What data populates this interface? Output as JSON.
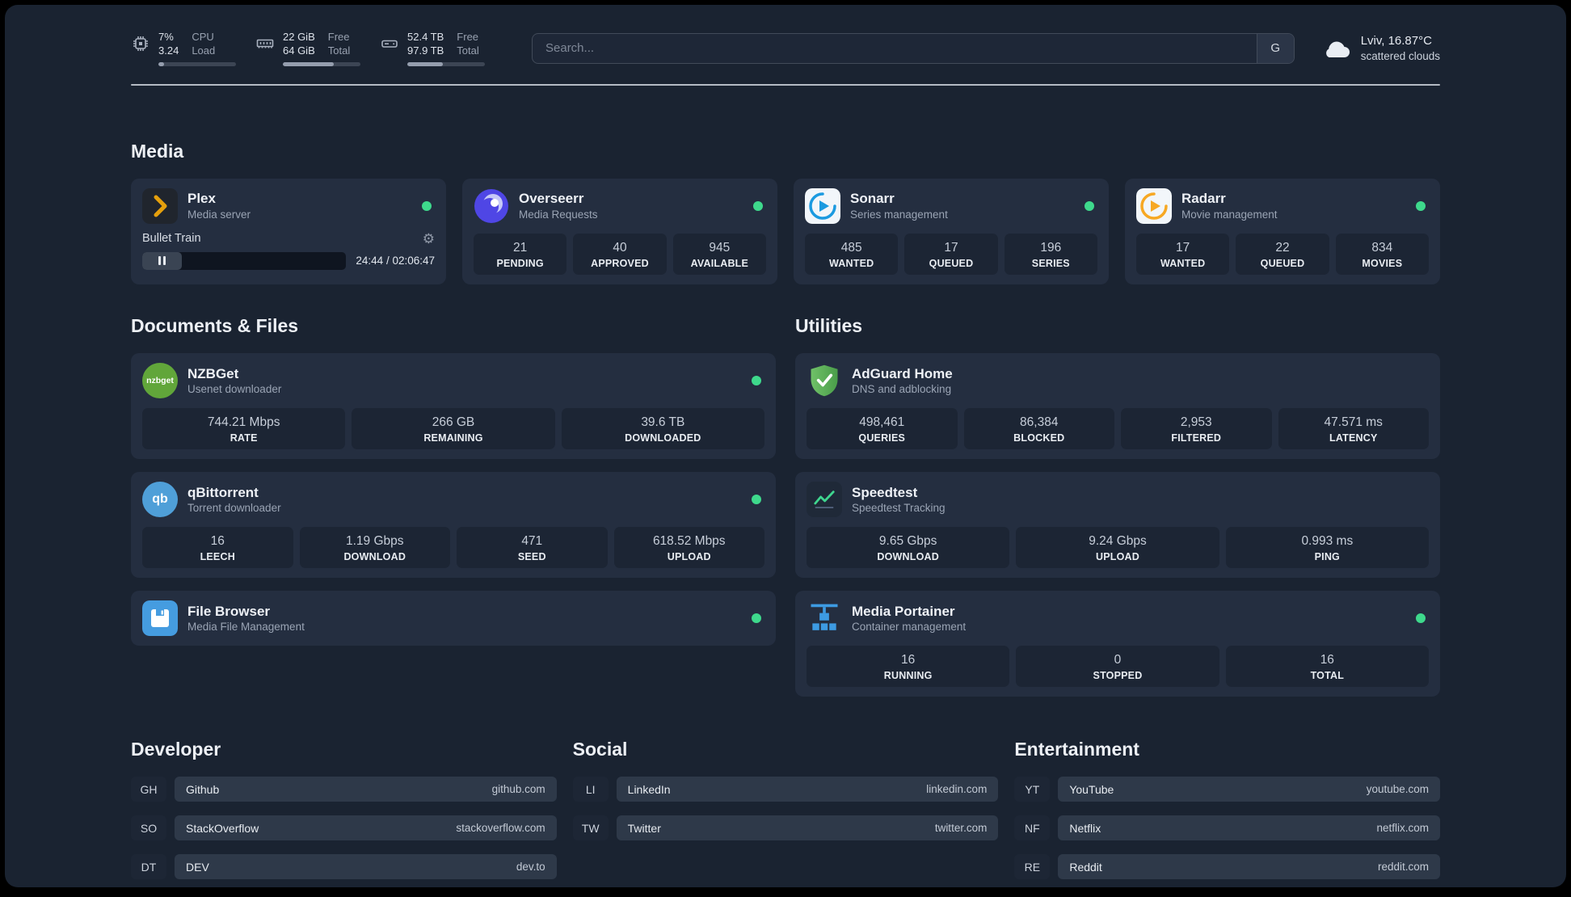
{
  "colors": {
    "status_ok": "#3ed98c",
    "accent_green_line": "#3fd68f",
    "plex_amber": "#e5a00d"
  },
  "topbar": {
    "cpu": {
      "value1": "7%",
      "value2": "3.24",
      "label1": "CPU",
      "label2": "Load",
      "bar_percent": 7
    },
    "memory": {
      "value1": "22 GiB",
      "value2": "64 GiB",
      "label1": "Free",
      "label2": "Total",
      "bar_percent": 66
    },
    "disk": {
      "value1": "52.4 TB",
      "value2": "97.9 TB",
      "label1": "Free",
      "label2": "Total",
      "bar_percent": 46
    },
    "search": {
      "placeholder": "Search...",
      "button_label": "G"
    },
    "weather": {
      "location": "Lviv, 16.87°C",
      "condition": "scattered clouds"
    }
  },
  "media": {
    "title": "Media",
    "plex": {
      "name": "Plex",
      "subtitle": "Media server",
      "now_playing": "Bullet Train",
      "time": "24:44 / 02:06:47",
      "progress_percent": 19.5
    },
    "overseerr": {
      "name": "Overseerr",
      "subtitle": "Media Requests",
      "stats": [
        {
          "value": "21",
          "label": "PENDING"
        },
        {
          "value": "40",
          "label": "APPROVED"
        },
        {
          "value": "945",
          "label": "AVAILABLE"
        }
      ]
    },
    "sonarr": {
      "name": "Sonarr",
      "subtitle": "Series management",
      "stats": [
        {
          "value": "485",
          "label": "WANTED"
        },
        {
          "value": "17",
          "label": "QUEUED"
        },
        {
          "value": "196",
          "label": "SERIES"
        }
      ]
    },
    "radarr": {
      "name": "Radarr",
      "subtitle": "Movie management",
      "stats": [
        {
          "value": "17",
          "label": "WANTED"
        },
        {
          "value": "22",
          "label": "QUEUED"
        },
        {
          "value": "834",
          "label": "MOVIES"
        }
      ]
    }
  },
  "documents": {
    "title": "Documents & Files",
    "nzbget": {
      "name": "NZBGet",
      "subtitle": "Usenet downloader",
      "stats": [
        {
          "value": "744.21 Mbps",
          "label": "RATE"
        },
        {
          "value": "266 GB",
          "label": "REMAINING"
        },
        {
          "value": "39.6 TB",
          "label": "DOWNLOADED"
        }
      ]
    },
    "qbittorrent": {
      "name": "qBittorrent",
      "subtitle": "Torrent downloader",
      "stats": [
        {
          "value": "16",
          "label": "LEECH"
        },
        {
          "value": "1.19 Gbps",
          "label": "DOWNLOAD"
        },
        {
          "value": "471",
          "label": "SEED"
        },
        {
          "value": "618.52 Mbps",
          "label": "UPLOAD"
        }
      ]
    },
    "filebrowser": {
      "name": "File Browser",
      "subtitle": "Media File Management"
    }
  },
  "utilities": {
    "title": "Utilities",
    "adguard": {
      "name": "AdGuard Home",
      "subtitle": "DNS and adblocking",
      "stats": [
        {
          "value": "498,461",
          "label": "QUERIES"
        },
        {
          "value": "86,384",
          "label": "BLOCKED"
        },
        {
          "value": "2,953",
          "label": "FILTERED"
        },
        {
          "value": "47.571 ms",
          "label": "LATENCY"
        }
      ]
    },
    "speedtest": {
      "name": "Speedtest",
      "subtitle": "Speedtest Tracking",
      "stats": [
        {
          "value": "9.65 Gbps",
          "label": "DOWNLOAD"
        },
        {
          "value": "9.24 Gbps",
          "label": "UPLOAD"
        },
        {
          "value": "0.993 ms",
          "label": "PING"
        }
      ]
    },
    "portainer": {
      "name": "Media Portainer",
      "subtitle": "Container management",
      "stats": [
        {
          "value": "16",
          "label": "RUNNING"
        },
        {
          "value": "0",
          "label": "STOPPED"
        },
        {
          "value": "16",
          "label": "TOTAL"
        }
      ]
    }
  },
  "bookmarks": {
    "developer": {
      "title": "Developer",
      "items": [
        {
          "abbr": "GH",
          "name": "Github",
          "url": "github.com"
        },
        {
          "abbr": "SO",
          "name": "StackOverflow",
          "url": "stackoverflow.com"
        },
        {
          "abbr": "DT",
          "name": "DEV",
          "url": "dev.to"
        }
      ]
    },
    "social": {
      "title": "Social",
      "items": [
        {
          "abbr": "LI",
          "name": "LinkedIn",
          "url": "linkedin.com"
        },
        {
          "abbr": "TW",
          "name": "Twitter",
          "url": "twitter.com"
        }
      ]
    },
    "entertainment": {
      "title": "Entertainment",
      "items": [
        {
          "abbr": "YT",
          "name": "YouTube",
          "url": "youtube.com"
        },
        {
          "abbr": "NF",
          "name": "Netflix",
          "url": "netflix.com"
        },
        {
          "abbr": "RE",
          "name": "Reddit",
          "url": "reddit.com"
        }
      ]
    }
  },
  "icons": {
    "gear": "⚙",
    "qb_text": "qb",
    "nzbget_text": "nzbget"
  }
}
